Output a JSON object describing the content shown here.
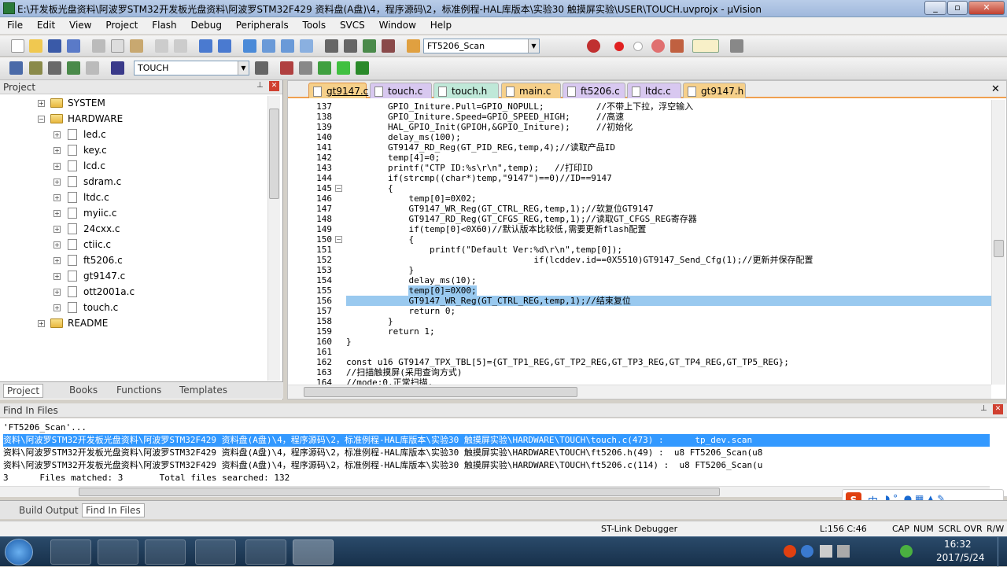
{
  "window": {
    "title": "E:\\开发板光盘资料\\阿波罗STM32开发板光盘资料\\阿波罗STM32F429 资料盘(A盘)\\4，程序源码\\2，标准例程-HAL库版本\\实验30 触摸屏实验\\USER\\TOUCH.uvprojx - µVision"
  },
  "menu": [
    "File",
    "Edit",
    "View",
    "Project",
    "Flash",
    "Debug",
    "Peripherals",
    "Tools",
    "SVCS",
    "Window",
    "Help"
  ],
  "toolbar": {
    "find_combo": "FT5206_Scan",
    "target_combo": "TOUCH"
  },
  "project": {
    "title": "Project",
    "tree": [
      {
        "label": "SYSTEM",
        "type": "folder"
      },
      {
        "label": "HARDWARE",
        "type": "folder"
      },
      {
        "label": "led.c",
        "type": "file"
      },
      {
        "label": "key.c",
        "type": "file"
      },
      {
        "label": "lcd.c",
        "type": "file"
      },
      {
        "label": "sdram.c",
        "type": "file"
      },
      {
        "label": "ltdc.c",
        "type": "file"
      },
      {
        "label": "myiic.c",
        "type": "file"
      },
      {
        "label": "24cxx.c",
        "type": "file"
      },
      {
        "label": "ctiic.c",
        "type": "file"
      },
      {
        "label": "ft5206.c",
        "type": "file"
      },
      {
        "label": "gt9147.c",
        "type": "file"
      },
      {
        "label": "ott2001a.c",
        "type": "file"
      },
      {
        "label": "touch.c",
        "type": "file"
      },
      {
        "label": "README",
        "type": "folder"
      }
    ],
    "tabs": [
      "Project",
      "Books",
      "Functions",
      "Templates"
    ]
  },
  "editor": {
    "tabs": [
      {
        "label": "gt9147.c",
        "color": "#f6d08a"
      },
      {
        "label": "touch.c",
        "color": "#d8c8f0"
      },
      {
        "label": "touch.h",
        "color": "#bfe8d8"
      },
      {
        "label": "main.c",
        "color": "#f6d08a"
      },
      {
        "label": "ft5206.c",
        "color": "#d8c8f0"
      },
      {
        "label": "ltdc.c",
        "color": "#d8c8f0"
      },
      {
        "label": "gt9147.h",
        "color": "#f6d08a"
      }
    ],
    "lines": [
      {
        "n": "137",
        "t": "        GPIO_Initure.Pull=GPIO_NOPULL;          //不带上下拉，浮空输入"
      },
      {
        "n": "138",
        "t": "        GPIO_Initure.Speed=GPIO_SPEED_HIGH;     //高速"
      },
      {
        "n": "139",
        "t": "        HAL_GPIO_Init(GPIOH,&GPIO_Initure);     //初始化"
      },
      {
        "n": "140",
        "t": "        delay_ms(100);"
      },
      {
        "n": "141",
        "t": "        GT9147_RD_Reg(GT_PID_REG,temp,4);//读取产品ID"
      },
      {
        "n": "142",
        "t": "        temp[4]=0;"
      },
      {
        "n": "143",
        "t": "        printf(\"CTP ID:%s\\r\\n\",temp);   //打印ID"
      },
      {
        "n": "144",
        "t": "        if(strcmp((char*)temp,\"9147\")==0)//ID==9147"
      },
      {
        "n": "145",
        "t": "        {"
      },
      {
        "n": "146",
        "t": "            temp[0]=0X02;"
      },
      {
        "n": "147",
        "t": "            GT9147_WR_Reg(GT_CTRL_REG,temp,1);//软复位GT9147"
      },
      {
        "n": "148",
        "t": "            GT9147_RD_Reg(GT_CFGS_REG,temp,1);//读取GT_CFGS_REG寄存器"
      },
      {
        "n": "149",
        "t": "            if(temp[0]<0X60)//默认版本比较低,需要更新flash配置"
      },
      {
        "n": "150",
        "t": "            {"
      },
      {
        "n": "151",
        "t": "                printf(\"Default Ver:%d\\r\\n\",temp[0]);"
      },
      {
        "n": "152",
        "t": "                                    if(lcddev.id==0X5510)GT9147_Send_Cfg(1);//更新并保存配置"
      },
      {
        "n": "153",
        "t": "            }"
      },
      {
        "n": "154",
        "t": "            delay_ms(10);"
      },
      {
        "n": "155",
        "t": "            temp[0]=0X00;"
      },
      {
        "n": "156",
        "t": "            GT9147_WR_Reg(GT_CTRL_REG,temp,1);//结束复位"
      },
      {
        "n": "157",
        "t": "            return 0;"
      },
      {
        "n": "158",
        "t": "        }"
      },
      {
        "n": "159",
        "t": "        return 1;"
      },
      {
        "n": "160",
        "t": "}"
      },
      {
        "n": "161",
        "t": ""
      },
      {
        "n": "162",
        "t": "const u16 GT9147_TPX_TBL[5]={GT_TP1_REG,GT_TP2_REG,GT_TP3_REG,GT_TP4_REG,GT_TP5_REG};"
      },
      {
        "n": "163",
        "t": "//扫描触摸屏(采用查询方式)"
      },
      {
        "n": "164",
        "t": "//mode:0,正常扫描."
      }
    ]
  },
  "find": {
    "title": "Find In Files",
    "lines": [
      "'FT5206_Scan'...",
      "资料\\阿波罗STM32开发板光盘资料\\阿波罗STM32F429 资料盘(A盘)\\4，程序源码\\2，标准例程-HAL库版本\\实验30 触摸屏实验\\HARDWARE\\TOUCH\\touch.c(473) :      tp_dev.scan",
      "资料\\阿波罗STM32开发板光盘资料\\阿波罗STM32F429 资料盘(A盘)\\4，程序源码\\2，标准例程-HAL库版本\\实验30 触摸屏实验\\HARDWARE\\TOUCH\\ft5206.h(49) :  u8 FT5206_Scan(u8",
      "资料\\阿波罗STM32开发板光盘资料\\阿波罗STM32F429 资料盘(A盘)\\4，程序源码\\2，标准例程-HAL库版本\\实验30 触摸屏实验\\HARDWARE\\TOUCH\\ft5206.c(114) :  u8 FT5206_Scan(u",
      "3      Files matched: 3       Total files searched: 132"
    ],
    "tabs": [
      "Build Output",
      "Find In Files"
    ]
  },
  "status": {
    "debugger": "ST-Link Debugger",
    "position": "L:156 C:46",
    "cap": "CAP",
    "num": "NUM",
    "scrl": "SCRL",
    "ovr": "OVR",
    "rw": "R/W"
  },
  "taskbar": {
    "time": "16:32",
    "date": "2017/5/24"
  },
  "ime": {
    "lang": "中"
  }
}
